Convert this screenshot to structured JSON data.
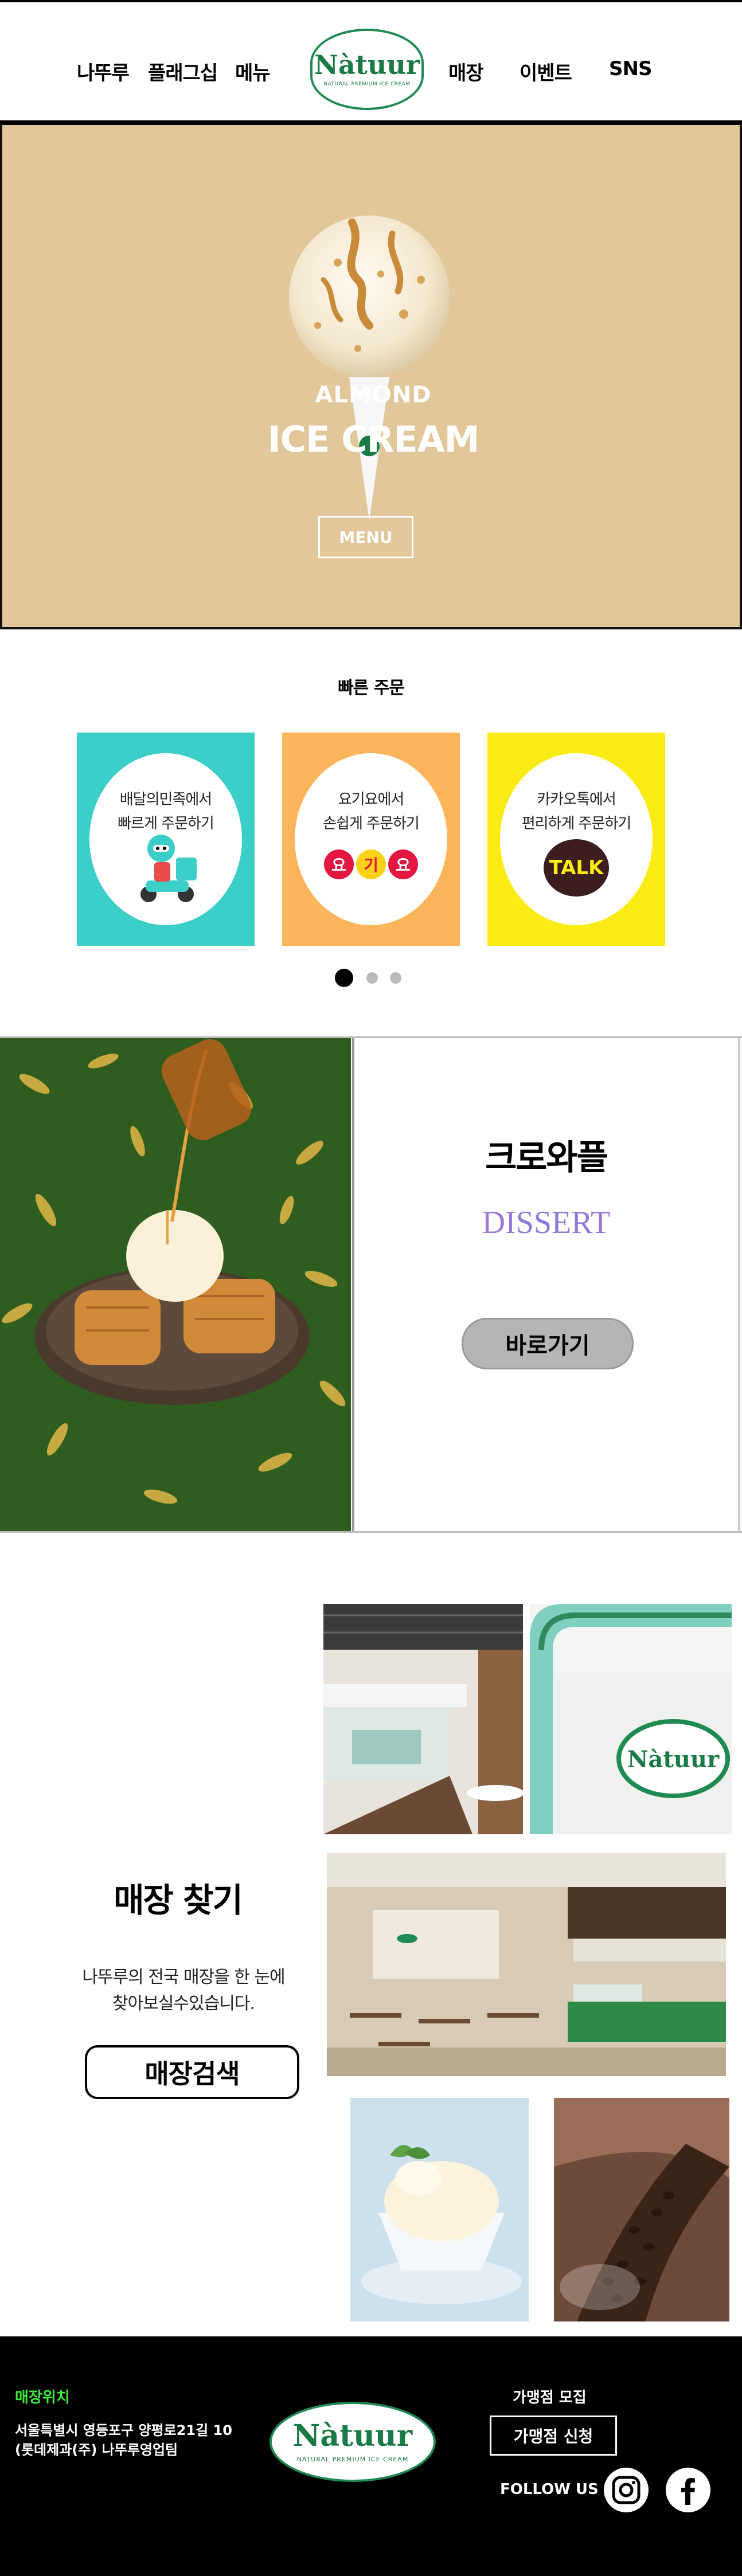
{
  "header": {
    "nav_left": [
      "나뚜루",
      "플래그십",
      "메뉴"
    ],
    "nav_right": [
      "매장",
      "이벤트",
      "SNS"
    ],
    "logo": {
      "brand": "Nàtuur",
      "tagline": "NATURAL PREMIUM ICE CREAM"
    }
  },
  "hero": {
    "line1": "ALMOND",
    "line2": "ICE CREAM",
    "menu_button": "MENU",
    "background_color": "#e2c79b"
  },
  "quick_order": {
    "title": "빠른 주문",
    "cards": [
      {
        "line1": "배달의민족에서",
        "line2": "빠르게 주문하기",
        "color": "#3ccfc9",
        "icon": "delivery-rider-icon"
      },
      {
        "line1": "요기요에서",
        "line2": "손쉽게 주문하기",
        "color": "#fdb55c",
        "icon": "yogiyo-logo-icon",
        "logo_letters": [
          "요",
          "기",
          "요"
        ]
      },
      {
        "line1": "카카오톡에서",
        "line2": "편리하게 주문하기",
        "color": "#faec14",
        "icon": "kakao-talk-icon",
        "logo_text": "TALK"
      }
    ],
    "carousel": {
      "pages": 3,
      "active": 1
    }
  },
  "croffle": {
    "title": "크로와플",
    "subtitle": "DISSERT",
    "button": "바로가기"
  },
  "store_find": {
    "title": "매장 찾기",
    "desc_line1": "나뚜루의 전국 매장을 한 눈에",
    "desc_line2": "찾아보실수있습니다.",
    "button": "매장검색",
    "sign_text": "Nàtuur"
  },
  "footer": {
    "location_label": "매장위치",
    "address_line1": "서울특별시 영등포구 양평로21길 10",
    "address_line2": "(롯데제과(주) 나뚜루영업팀",
    "franchise_label": "가맹점 모집",
    "apply_button": "가맹점 신청",
    "follow_label": "FOLLOW US",
    "logo": {
      "brand": "Nàtuur",
      "tagline": "NATURAL PREMIUM ICE CREAM"
    },
    "social_icons": [
      "instagram-icon",
      "facebook-icon"
    ],
    "location_color": "#3ee83e"
  }
}
